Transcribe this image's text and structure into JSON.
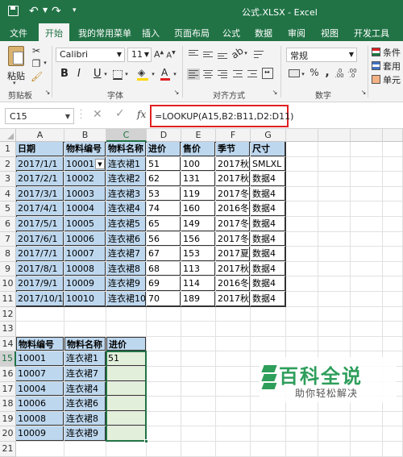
{
  "titlebar": {
    "title": "公式.XLSX - Excel"
  },
  "tabs": [
    "文件",
    "开始",
    "我的常用菜单",
    "插入",
    "页面布局",
    "公式",
    "数据",
    "审阅",
    "视图",
    "开发工具"
  ],
  "ribbon": {
    "paste_label": "粘贴",
    "font_name": "Calibri",
    "font_size": "11",
    "bold": "B",
    "italic": "I",
    "underline": "U",
    "number_format": "常规",
    "cond_format": "条件",
    "table_format": "套用",
    "cell_style": "单元",
    "groups": {
      "clipboard": "剪贴板",
      "font": "字体",
      "alignment": "对齐方式",
      "number": "数字"
    }
  },
  "formula_bar": {
    "name_box": "C15",
    "fx": "fx",
    "formula": "=LOOKUP(A15,B2:B11,D2:D11)"
  },
  "sheet": {
    "columns": [
      "A",
      "B",
      "C",
      "D",
      "E",
      "F",
      "G"
    ],
    "rows": [
      "1",
      "2",
      "3",
      "4",
      "5",
      "6",
      "7",
      "8",
      "9",
      "10",
      "11",
      "12",
      "13",
      "14",
      "15",
      "16",
      "17",
      "18",
      "19",
      "20",
      "21"
    ],
    "header": [
      "日期",
      "物料编号",
      "物料名称",
      "进价",
      "售价",
      "季节",
      "尺寸"
    ],
    "data": [
      [
        "2017/1/1",
        "10001",
        "连衣裙1",
        "51",
        "100",
        "2017秋",
        "SMLXL"
      ],
      [
        "2017/2/1",
        "10002",
        "连衣裙2",
        "62",
        "131",
        "2017秋",
        "数据4"
      ],
      [
        "2017/3/1",
        "10003",
        "连衣裙3",
        "53",
        "119",
        "2017冬",
        "数据4"
      ],
      [
        "2017/4/1",
        "10004",
        "连衣裙4",
        "74",
        "160",
        "2016冬",
        "数据4"
      ],
      [
        "2017/5/1",
        "10005",
        "连衣裙5",
        "65",
        "149",
        "2017冬",
        "数据4"
      ],
      [
        "2017/6/1",
        "10006",
        "连衣裙6",
        "56",
        "156",
        "2017冬",
        "数据4"
      ],
      [
        "2017/7/1",
        "10007",
        "连衣裙7",
        "67",
        "153",
        "2017夏",
        "数据4"
      ],
      [
        "2017/8/1",
        "10008",
        "连衣裙8",
        "68",
        "113",
        "2017秋",
        "数据4"
      ],
      [
        "2017/9/1",
        "10009",
        "连衣裙9",
        "69",
        "114",
        "2016冬",
        "数据4"
      ],
      [
        "2017/10/1",
        "10010",
        "连衣裙10",
        "70",
        "189",
        "2017秋",
        "数据4"
      ]
    ],
    "lookup_header": [
      "物料编号",
      "物料名称",
      "进价"
    ],
    "lookup_rows": [
      [
        "10001",
        "连衣裙1",
        "51"
      ],
      [
        "10007",
        "连衣裙7",
        ""
      ],
      [
        "10004",
        "连衣裙4",
        ""
      ],
      [
        "10006",
        "连衣裙6",
        ""
      ],
      [
        "10008",
        "连衣裙8",
        ""
      ],
      [
        "10009",
        "连衣裙9",
        ""
      ]
    ]
  },
  "watermark": {
    "title": "百科全说",
    "subtitle": "助你轻松解决"
  },
  "colors": {
    "excel_green": "#217346",
    "cell_blue": "#bdd7ee",
    "active_green": "#e2efda",
    "highlight_red": "#e02020"
  }
}
